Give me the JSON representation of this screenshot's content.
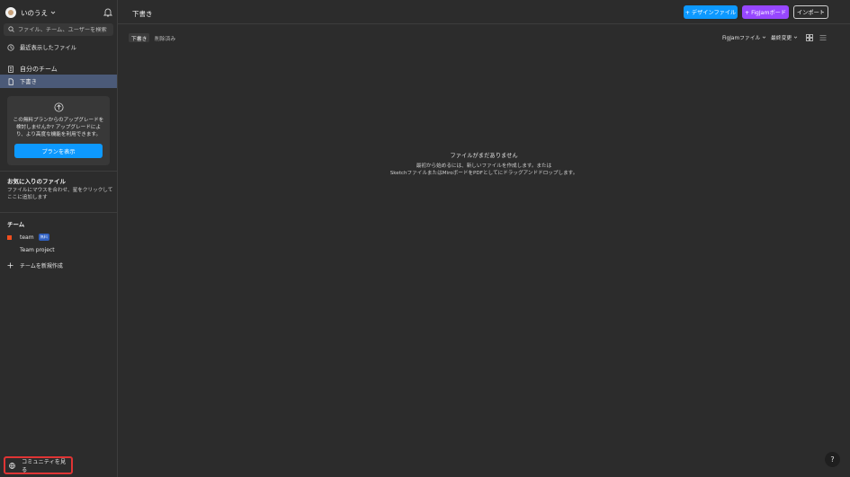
{
  "user": {
    "name": "いのうえ"
  },
  "search": {
    "placeholder": "ファイル、チーム、ユーザーを検索"
  },
  "sidebar": {
    "recent_label": "最近表示したファイル",
    "my_team_label": "自分のチーム",
    "drafts_label": "下書き",
    "upgrade": {
      "text": "この無料プランからのアップグレードを検討しませんか? アップグレードにより、より高度な機能を利用できます。",
      "button_label": "プランを表示"
    },
    "favorites": {
      "title": "お気に入りのファイル",
      "description": "ファイルにマウスを合わせ、星をクリックしてここに追加します"
    },
    "teams": {
      "title": "チーム",
      "team_name": "team",
      "team_badge": "無料",
      "project_name": "Team project",
      "new_team_label": "チームを新規作成"
    },
    "community_label": "コミュニティを見る"
  },
  "header": {
    "title": "下書き",
    "design_file_label": "+ デザインファイル",
    "figjam_label": "+ FigJamボード",
    "import_label": "インポート"
  },
  "tabs": {
    "drafts": "下書き",
    "deleted": "削除済み"
  },
  "filters": {
    "file_type": "FigJamファイル",
    "sort": "最終変更"
  },
  "empty_state": {
    "title": "ファイルがまだありません",
    "line1": "最初から始めるには、新しいファイルを作成します。または",
    "line2": "SketchファイルまたはMiroボードをPDFとしてにドラッグアンドドロップします。"
  },
  "help": {
    "label": "?"
  },
  "colors": {
    "background": "#2c2c2c",
    "accent_blue": "#0d99ff",
    "accent_purple": "#9747ff",
    "selected_nav": "#4b5a78",
    "highlight_red": "#e03434"
  }
}
